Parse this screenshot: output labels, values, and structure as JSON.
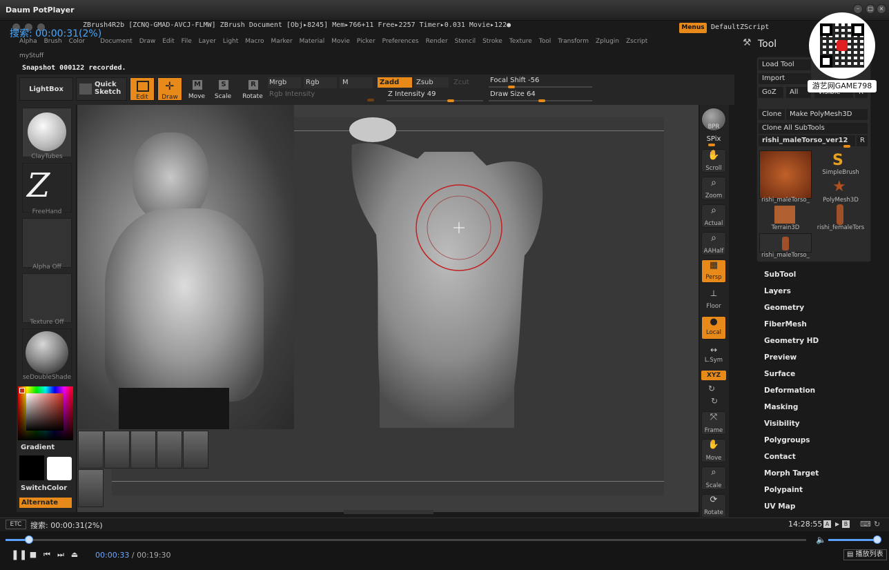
{
  "player": {
    "title": "Daum PotPlayer",
    "search_overlay": "搜索: 00:00:31(2%)",
    "status_left_btn": "ETC",
    "status_text": "搜索: 00:00:31(2%)",
    "clock": "14:28:55",
    "time_current": "00:00:33",
    "time_separator": "/",
    "time_total": "00:19:30",
    "playlist_btn": "播放列表",
    "progress_fraction": 0.029
  },
  "zbrush": {
    "info_line": "ZBrush4R2b [ZCNQ-GMAD-AVCJ-FLMW]    ZBrush Document    [Obj▸8245] Mem▸766+11 Free▸2257 Timer▸0.031 Movie▸122●",
    "menus_btn": "Menus",
    "default_zscript": "DefaultZScript",
    "menu_items": [
      "Alpha",
      "Brush",
      "Color",
      "Document",
      "Draw",
      "Edit",
      "File",
      "Layer",
      "Light",
      "Macro",
      "Marker",
      "Material",
      "Movie",
      "Picker",
      "Preferences",
      "Render",
      "Stencil",
      "Stroke",
      "Texture",
      "Tool",
      "Transform",
      "Zplugin",
      "Zscript"
    ],
    "mystuff": "myStuff",
    "snapshot": "Snapshot 000122 recorded.",
    "toolbar": {
      "lightbox": "LightBox",
      "quick_sketch": "Quick Sketch",
      "edit": "Edit",
      "draw": "Draw",
      "move": "Move",
      "scale": "Scale",
      "rotate": "Rotate",
      "mrgb": "Mrgb",
      "rgb": "Rgb",
      "m": "M",
      "rgb_intensity": "Rgb Intensity",
      "zadd": "Zadd",
      "zsub": "Zsub",
      "zcut": "Zcut",
      "z_intensity": "Z Intensity 49",
      "focal_shift": "Focal Shift -56",
      "draw_size": "Draw Size 64"
    },
    "shelf": {
      "brush": "ClayTubes",
      "stroke": "FreeHand",
      "alpha": "Alpha Off",
      "texture": "Texture Off",
      "material": "seDoubleShade",
      "gradient": "Gradient",
      "switchcolor": "SwitchColor",
      "alternate": "Alternate"
    },
    "right_tools": [
      "BPR",
      "SPix",
      "Scroll",
      "Zoom",
      "Actual",
      "AAHalf",
      "Persp",
      "Floor",
      "Local",
      "L.Sym",
      "XYZ",
      "Frame",
      "Move",
      "Scale",
      "Rotate"
    ],
    "tool_palette": {
      "title": "Tool",
      "load_tool": "Load Tool",
      "import": "Import",
      "goz": "GoZ",
      "all": "All",
      "visible": "Visible",
      "r": "R",
      "clone": "Clone",
      "make_polymesh": "Make PolyMesh3D",
      "clone_all": "Clone All SubTools",
      "current_tool": "rishi_maleTorso_ver12",
      "subtools": [
        {
          "caption": "rishi_maleTorso_"
        },
        {
          "caption": "SimpleBrush"
        },
        {
          "caption": "PolyMesh3D"
        },
        {
          "caption": "Terrain3D"
        },
        {
          "caption": "rishi_femaleTors"
        },
        {
          "caption": "rishi_maleTorso_"
        }
      ],
      "sections": [
        "SubTool",
        "Layers",
        "Geometry",
        "FiberMesh",
        "Geometry HD",
        "Preview",
        "Surface",
        "Deformation",
        "Masking",
        "Visibility",
        "Polygroups",
        "Contact",
        "Morph Target",
        "Polypaint",
        "UV Map"
      ]
    },
    "watermark": "游艺网GAME798"
  },
  "colors": {
    "accent": "#e88a1a",
    "player_blue": "#5aa0ff"
  }
}
